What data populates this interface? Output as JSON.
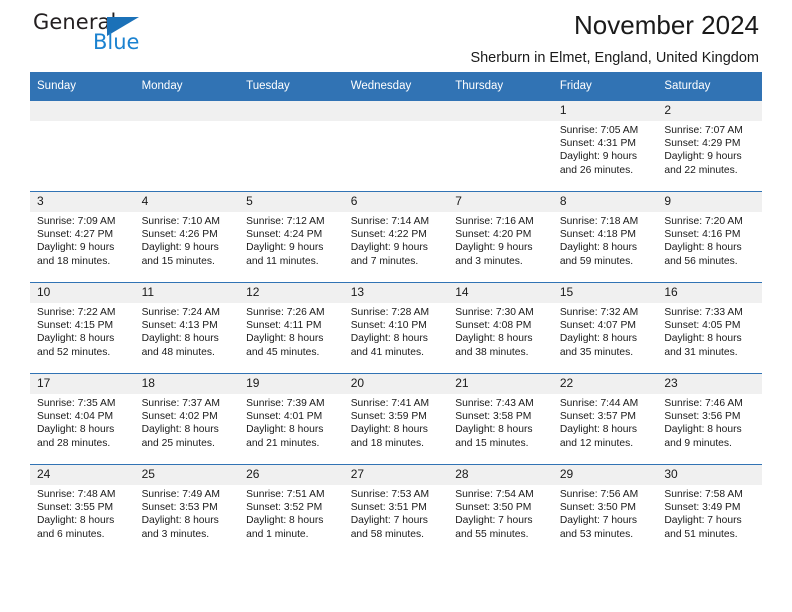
{
  "logo": {
    "word_one": "General",
    "word_two": "Blue",
    "triangle_icon": "triangle-icon",
    "brand_blue": "#1b82d0",
    "triangle_blue": "#1b71b8"
  },
  "header": {
    "title": "November 2024",
    "subtitle": "Sherburn in Elmet, England, United Kingdom"
  },
  "theme": {
    "header_blue": "#3173b4",
    "daynum_band_gray": "#f0f0f0",
    "text_color": "#1a1a1a"
  },
  "weekday_headers": [
    "Sunday",
    "Monday",
    "Tuesday",
    "Wednesday",
    "Thursday",
    "Friday",
    "Saturday"
  ],
  "weeks": [
    [
      {
        "day": "",
        "lines": []
      },
      {
        "day": "",
        "lines": []
      },
      {
        "day": "",
        "lines": []
      },
      {
        "day": "",
        "lines": []
      },
      {
        "day": "",
        "lines": []
      },
      {
        "day": "1",
        "lines": [
          "Sunrise: 7:05 AM",
          "Sunset: 4:31 PM",
          "Daylight: 9 hours",
          "and 26 minutes."
        ]
      },
      {
        "day": "2",
        "lines": [
          "Sunrise: 7:07 AM",
          "Sunset: 4:29 PM",
          "Daylight: 9 hours",
          "and 22 minutes."
        ]
      }
    ],
    [
      {
        "day": "3",
        "lines": [
          "Sunrise: 7:09 AM",
          "Sunset: 4:27 PM",
          "Daylight: 9 hours",
          "and 18 minutes."
        ]
      },
      {
        "day": "4",
        "lines": [
          "Sunrise: 7:10 AM",
          "Sunset: 4:26 PM",
          "Daylight: 9 hours",
          "and 15 minutes."
        ]
      },
      {
        "day": "5",
        "lines": [
          "Sunrise: 7:12 AM",
          "Sunset: 4:24 PM",
          "Daylight: 9 hours",
          "and 11 minutes."
        ]
      },
      {
        "day": "6",
        "lines": [
          "Sunrise: 7:14 AM",
          "Sunset: 4:22 PM",
          "Daylight: 9 hours",
          "and 7 minutes."
        ]
      },
      {
        "day": "7",
        "lines": [
          "Sunrise: 7:16 AM",
          "Sunset: 4:20 PM",
          "Daylight: 9 hours",
          "and 3 minutes."
        ]
      },
      {
        "day": "8",
        "lines": [
          "Sunrise: 7:18 AM",
          "Sunset: 4:18 PM",
          "Daylight: 8 hours",
          "and 59 minutes."
        ]
      },
      {
        "day": "9",
        "lines": [
          "Sunrise: 7:20 AM",
          "Sunset: 4:16 PM",
          "Daylight: 8 hours",
          "and 56 minutes."
        ]
      }
    ],
    [
      {
        "day": "10",
        "lines": [
          "Sunrise: 7:22 AM",
          "Sunset: 4:15 PM",
          "Daylight: 8 hours",
          "and 52 minutes."
        ]
      },
      {
        "day": "11",
        "lines": [
          "Sunrise: 7:24 AM",
          "Sunset: 4:13 PM",
          "Daylight: 8 hours",
          "and 48 minutes."
        ]
      },
      {
        "day": "12",
        "lines": [
          "Sunrise: 7:26 AM",
          "Sunset: 4:11 PM",
          "Daylight: 8 hours",
          "and 45 minutes."
        ]
      },
      {
        "day": "13",
        "lines": [
          "Sunrise: 7:28 AM",
          "Sunset: 4:10 PM",
          "Daylight: 8 hours",
          "and 41 minutes."
        ]
      },
      {
        "day": "14",
        "lines": [
          "Sunrise: 7:30 AM",
          "Sunset: 4:08 PM",
          "Daylight: 8 hours",
          "and 38 minutes."
        ]
      },
      {
        "day": "15",
        "lines": [
          "Sunrise: 7:32 AM",
          "Sunset: 4:07 PM",
          "Daylight: 8 hours",
          "and 35 minutes."
        ]
      },
      {
        "day": "16",
        "lines": [
          "Sunrise: 7:33 AM",
          "Sunset: 4:05 PM",
          "Daylight: 8 hours",
          "and 31 minutes."
        ]
      }
    ],
    [
      {
        "day": "17",
        "lines": [
          "Sunrise: 7:35 AM",
          "Sunset: 4:04 PM",
          "Daylight: 8 hours",
          "and 28 minutes."
        ]
      },
      {
        "day": "18",
        "lines": [
          "Sunrise: 7:37 AM",
          "Sunset: 4:02 PM",
          "Daylight: 8 hours",
          "and 25 minutes."
        ]
      },
      {
        "day": "19",
        "lines": [
          "Sunrise: 7:39 AM",
          "Sunset: 4:01 PM",
          "Daylight: 8 hours",
          "and 21 minutes."
        ]
      },
      {
        "day": "20",
        "lines": [
          "Sunrise: 7:41 AM",
          "Sunset: 3:59 PM",
          "Daylight: 8 hours",
          "and 18 minutes."
        ]
      },
      {
        "day": "21",
        "lines": [
          "Sunrise: 7:43 AM",
          "Sunset: 3:58 PM",
          "Daylight: 8 hours",
          "and 15 minutes."
        ]
      },
      {
        "day": "22",
        "lines": [
          "Sunrise: 7:44 AM",
          "Sunset: 3:57 PM",
          "Daylight: 8 hours",
          "and 12 minutes."
        ]
      },
      {
        "day": "23",
        "lines": [
          "Sunrise: 7:46 AM",
          "Sunset: 3:56 PM",
          "Daylight: 8 hours",
          "and 9 minutes."
        ]
      }
    ],
    [
      {
        "day": "24",
        "lines": [
          "Sunrise: 7:48 AM",
          "Sunset: 3:55 PM",
          "Daylight: 8 hours",
          "and 6 minutes."
        ]
      },
      {
        "day": "25",
        "lines": [
          "Sunrise: 7:49 AM",
          "Sunset: 3:53 PM",
          "Daylight: 8 hours",
          "and 3 minutes."
        ]
      },
      {
        "day": "26",
        "lines": [
          "Sunrise: 7:51 AM",
          "Sunset: 3:52 PM",
          "Daylight: 8 hours",
          "and 1 minute."
        ]
      },
      {
        "day": "27",
        "lines": [
          "Sunrise: 7:53 AM",
          "Sunset: 3:51 PM",
          "Daylight: 7 hours",
          "and 58 minutes."
        ]
      },
      {
        "day": "28",
        "lines": [
          "Sunrise: 7:54 AM",
          "Sunset: 3:50 PM",
          "Daylight: 7 hours",
          "and 55 minutes."
        ]
      },
      {
        "day": "29",
        "lines": [
          "Sunrise: 7:56 AM",
          "Sunset: 3:50 PM",
          "Daylight: 7 hours",
          "and 53 minutes."
        ]
      },
      {
        "day": "30",
        "lines": [
          "Sunrise: 7:58 AM",
          "Sunset: 3:49 PM",
          "Daylight: 7 hours",
          "and 51 minutes."
        ]
      }
    ]
  ]
}
